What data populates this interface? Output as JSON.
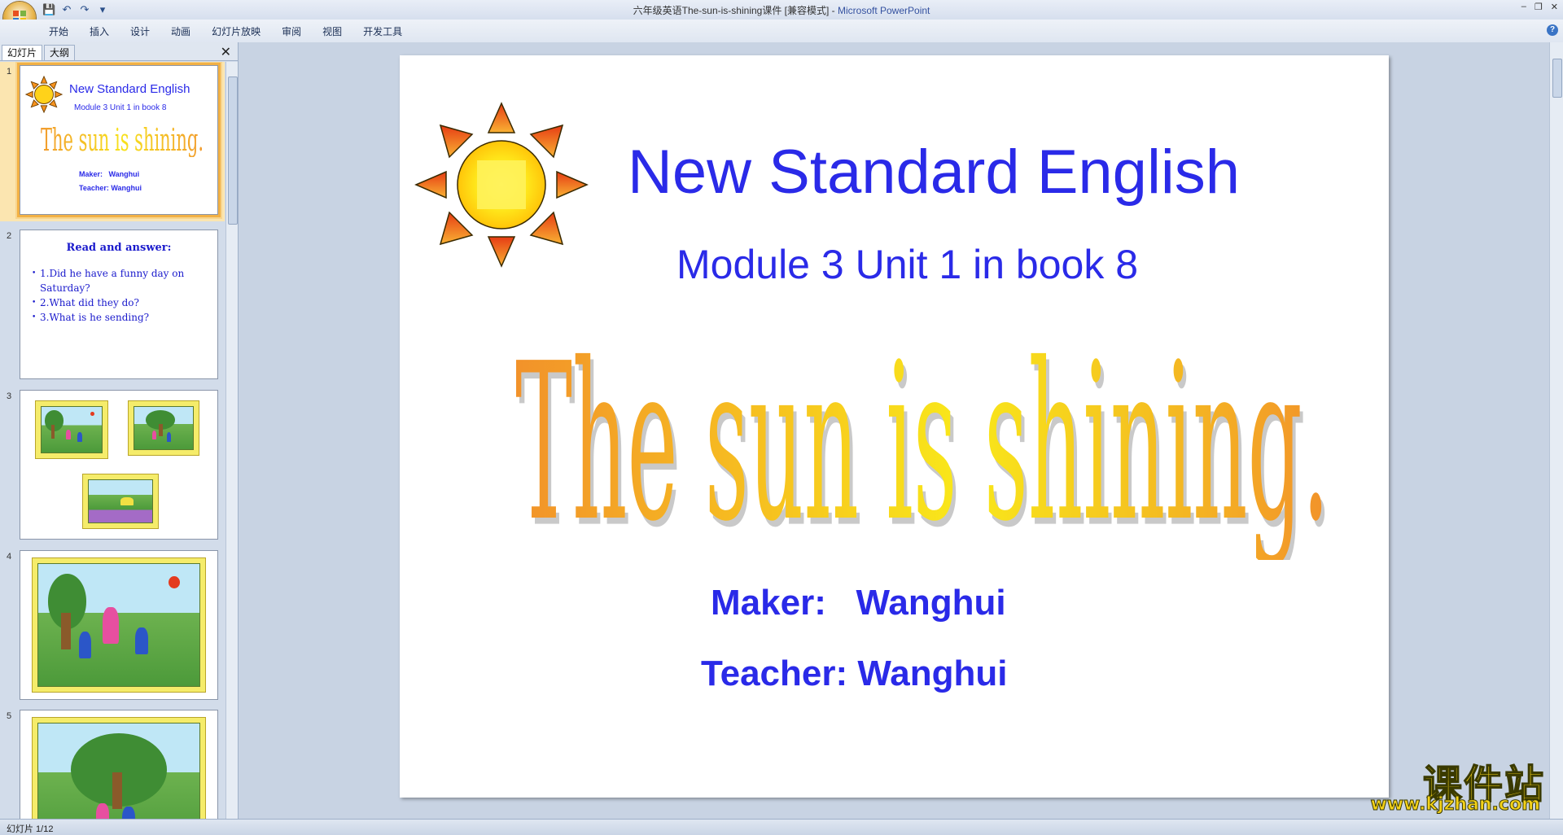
{
  "window": {
    "title": "六年级英语The-sun-is-shining课件 [兼容模式] - ",
    "app_name": "Microsoft PowerPoint"
  },
  "ribbon": {
    "tabs": [
      "开始",
      "插入",
      "设计",
      "动画",
      "幻灯片放映",
      "审阅",
      "视图",
      "开发工具"
    ]
  },
  "left_panel": {
    "tab_slides": "幻灯片",
    "tab_outline": "大纲",
    "slide_numbers": [
      "1",
      "2",
      "3",
      "4",
      "5"
    ]
  },
  "thumb1": {
    "title": "New Standard English",
    "subtitle": "Module 3  Unit 1 in book 8",
    "wordart": "The sun is shining.",
    "maker": "Maker:   Wanghui",
    "teacher": "Teacher: Wanghui"
  },
  "thumb2": {
    "heading": "Read and answer:",
    "items": [
      "1.Did he have  a funny  day on Saturday?",
      "2.What  did they  do?",
      "3.What  is  he  sending?"
    ]
  },
  "slide": {
    "title": "New Standard English",
    "subtitle": "Module 3  Unit 1 in book 8",
    "wordart": "The sun is shining.",
    "maker": "Maker:   Wanghui",
    "teacher": "Teacher: Wanghui"
  },
  "status": {
    "slide_position": "幻灯片 1/12"
  },
  "watermark": {
    "cn": "课件站",
    "url": "www.kjzhan.com"
  },
  "colors": {
    "slide_text": "#2a2ae8",
    "wordart_orange": "#f29b2f",
    "wordart_yellow": "#f7e21c",
    "selection": "#f2b145"
  }
}
